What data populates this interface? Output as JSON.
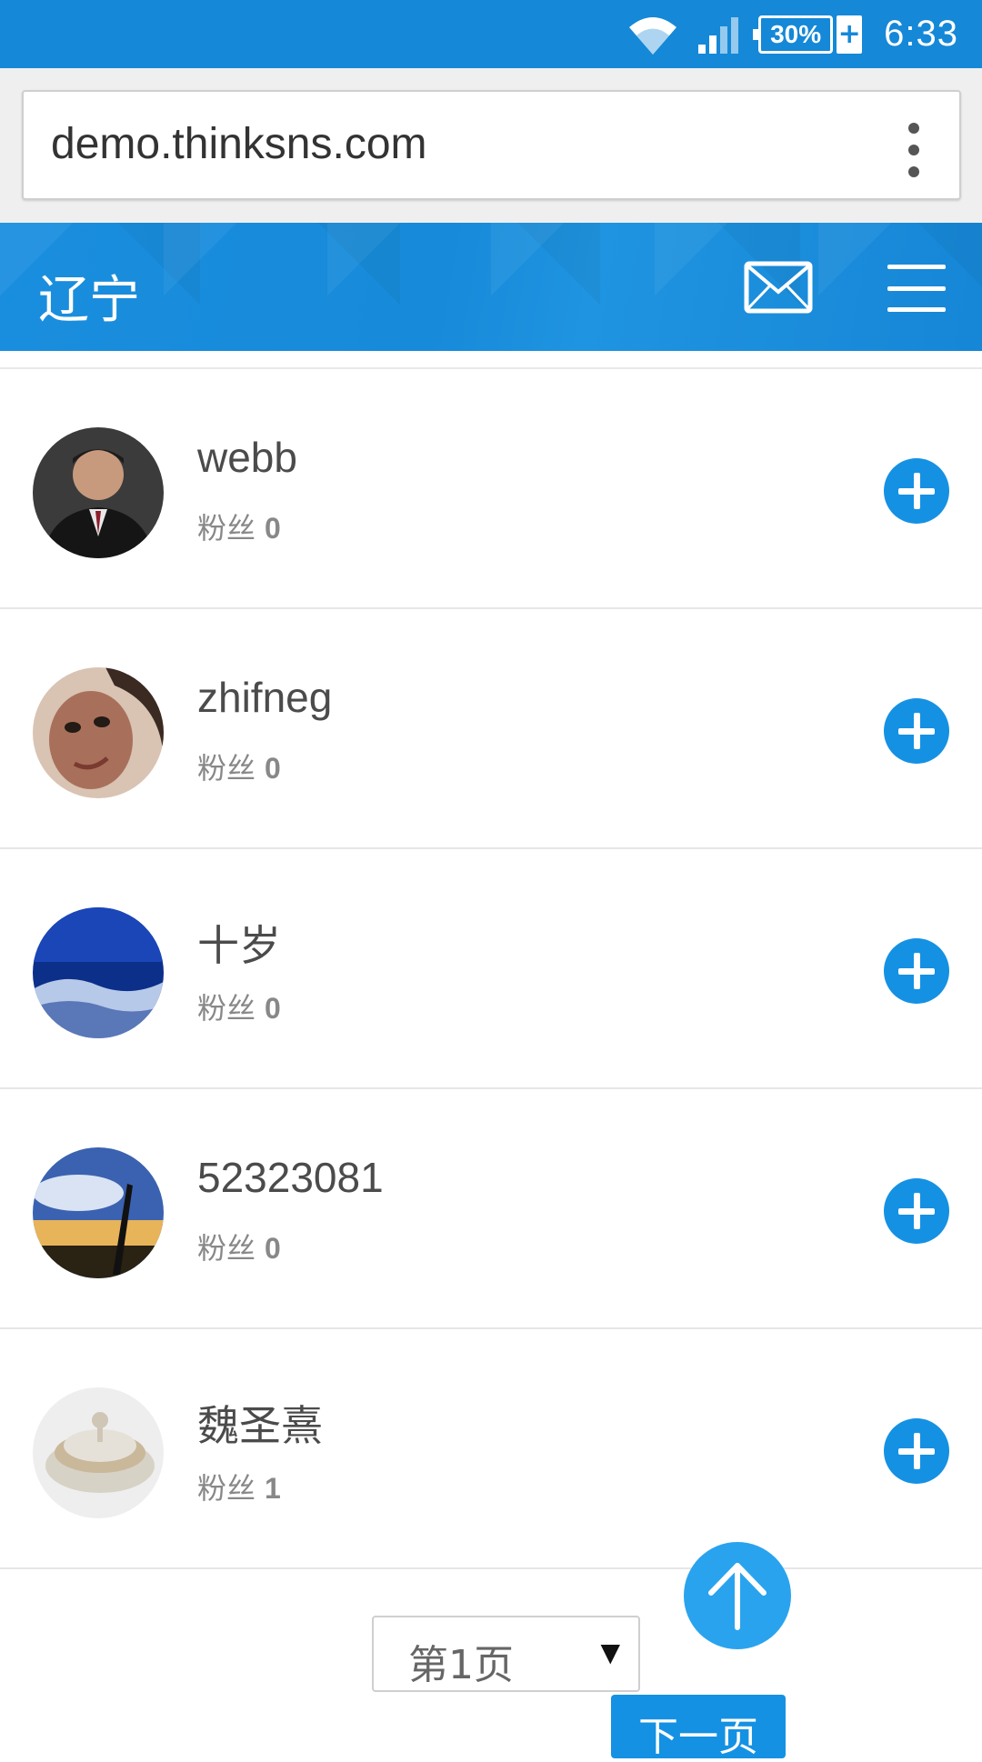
{
  "status_bar": {
    "battery": "30%",
    "battery_plus": "+",
    "time": "6:33"
  },
  "browser": {
    "url": "demo.thinksns.com"
  },
  "header": {
    "title": "辽宁",
    "mail_icon": "mail-icon",
    "menu_icon": "hamburger-menu-icon"
  },
  "fans_label": "粉丝",
  "users": [
    {
      "name": "webb",
      "fans": "0",
      "avatar_icon": "man-portrait"
    },
    {
      "name": "zhifneg",
      "fans": "0",
      "avatar_icon": "woman-portrait"
    },
    {
      "name": "十岁",
      "fans": "0",
      "avatar_icon": "blue-forest"
    },
    {
      "name": "52323081",
      "fans": "0",
      "avatar_icon": "sunset-sky"
    },
    {
      "name": "魏圣熹",
      "fans": "1",
      "avatar_icon": "jewelry-box"
    }
  ],
  "pagination": {
    "current_page": "第1页",
    "next_label": "下一页"
  },
  "colors": {
    "primary": "#1591e3",
    "status_bar": "#1588d8"
  }
}
